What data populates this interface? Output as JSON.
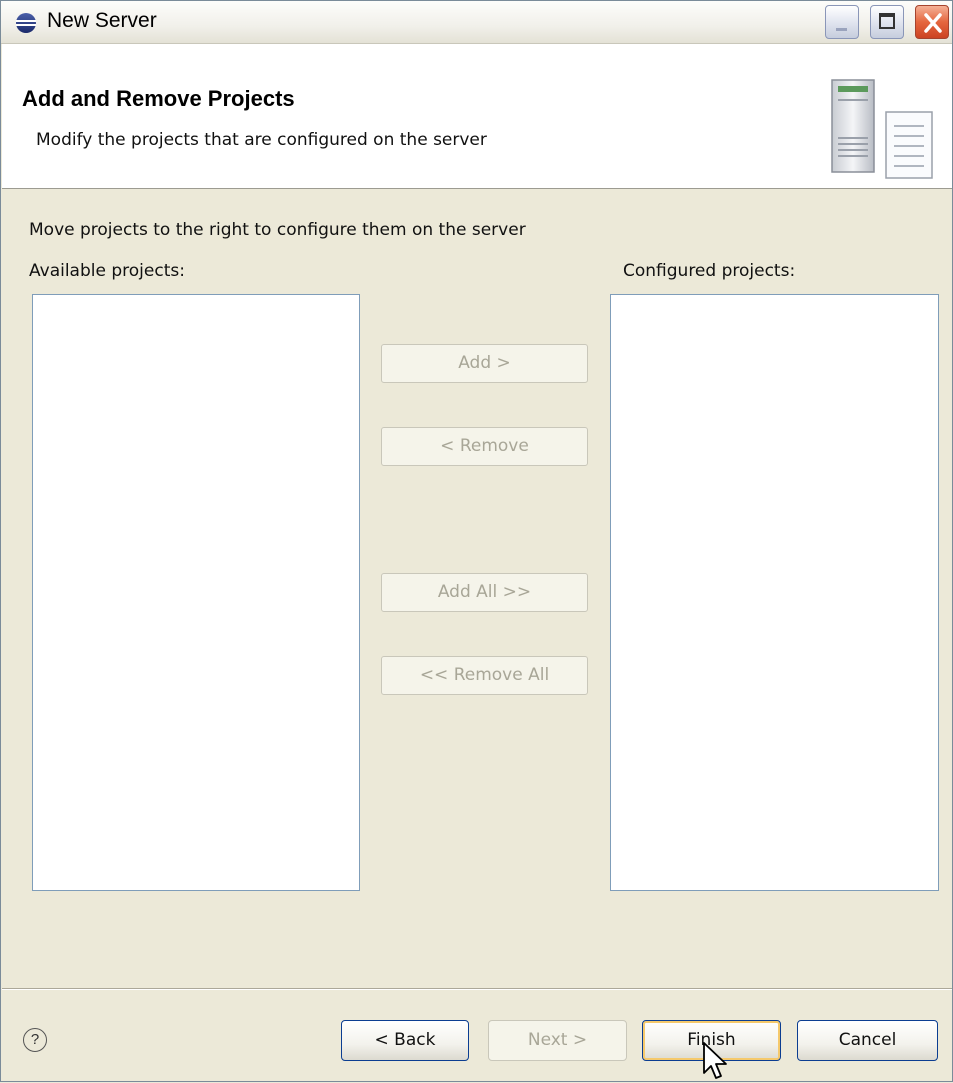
{
  "window": {
    "title": "New Server"
  },
  "header": {
    "title": "Add and Remove Projects",
    "subtitle": "Modify the projects that are configured on the server"
  },
  "main": {
    "instruction": "Move projects to the right to configure them on the server",
    "available_label": "Available projects:",
    "configured_label": "Configured projects:",
    "available_items": [],
    "configured_items": [],
    "buttons": {
      "add": "Add >",
      "remove": "< Remove",
      "add_all": "Add All >>",
      "remove_all": "<< Remove All"
    }
  },
  "footer": {
    "help_glyph": "?",
    "back": "< Back",
    "next": "Next >",
    "finish": "Finish",
    "cancel": "Cancel"
  },
  "colors": {
    "dialog_bg": "#ece9d8",
    "close_button": "#e5663e",
    "disabled_text": "#a8a697",
    "default_button_glow": "#f5c96c"
  }
}
